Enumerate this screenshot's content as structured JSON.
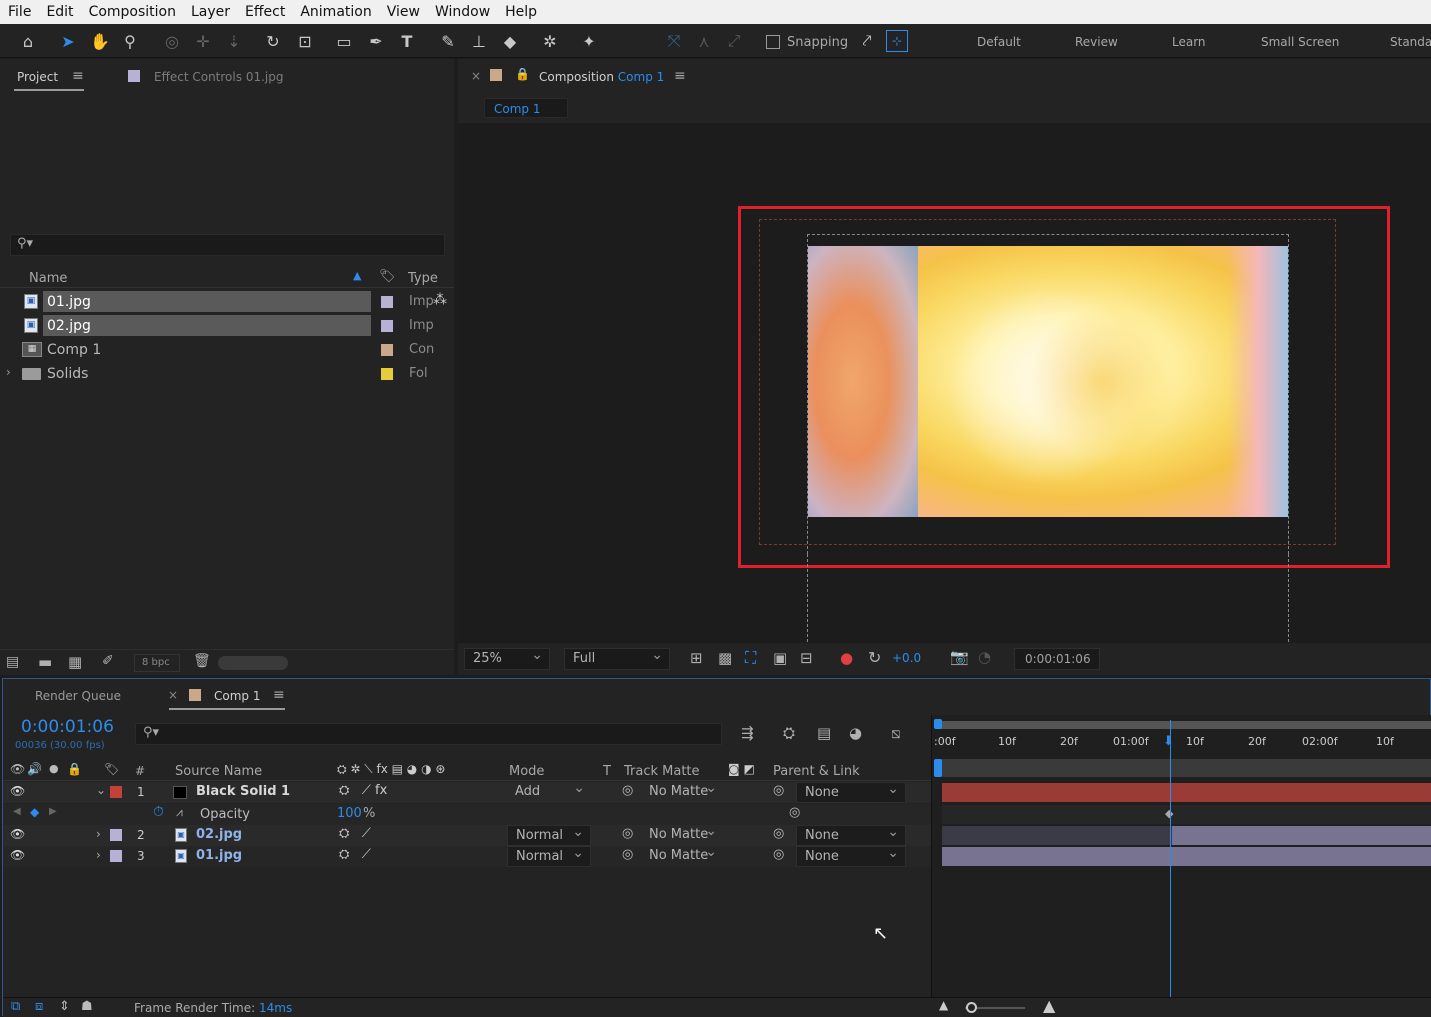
{
  "menu": [
    "File",
    "Edit",
    "Composition",
    "Layer",
    "Effect",
    "Animation",
    "View",
    "Window",
    "Help"
  ],
  "toolbar": {
    "snapping_label": "Snapping"
  },
  "workspaces": [
    "Default",
    "Review",
    "Learn",
    "Small Screen",
    "Standa"
  ],
  "project_panel": {
    "tab_project": "Project",
    "tab_effect_controls": "Effect Controls",
    "effect_controls_target": "01.jpg",
    "search_placeholder": "",
    "col_name": "Name",
    "col_type": "Type",
    "items": [
      {
        "name": "01.jpg",
        "type": "Imp",
        "color": "#b7b1d6",
        "selected": true
      },
      {
        "name": "02.jpg",
        "type": "Imp",
        "color": "#b7b1d6",
        "selected": true
      },
      {
        "name": "Comp 1",
        "type": "Con",
        "color": "#c9a98a",
        "selected": false
      },
      {
        "name": "Solids",
        "type": "Fol",
        "color": "#e6cc3a",
        "selected": false
      }
    ],
    "bpc_label": "8 bpc"
  },
  "comp_panel": {
    "tab_prefix": "Composition",
    "tab_name": "Comp 1",
    "breadcrumb": "Comp 1",
    "zoom": "25%",
    "resolution": "Full",
    "exposure": "+0.0",
    "timecode": "0:00:01:06"
  },
  "timeline": {
    "tab_render_queue": "Render Queue",
    "tab_comp": "Comp 1",
    "timecode": "0:00:01:06",
    "frame_info": "00036 (30.00 fps)",
    "headers": {
      "hash": "#",
      "source": "Source Name",
      "mode": "Mode",
      "t": "T",
      "track_matte": "Track Matte",
      "parent": "Parent & Link"
    },
    "ruler": [
      ":00f",
      "10f",
      "20f",
      "01:00f",
      "10f",
      "20f",
      "02:00f",
      "10f"
    ],
    "layers": [
      {
        "num": "1",
        "name": "Black Solid 1",
        "mode": "Add",
        "matte": "No Matte",
        "parent": "None",
        "label": "#c0423a"
      },
      {
        "num": "2",
        "name": "02.jpg",
        "mode": "Normal",
        "matte": "No Matte",
        "parent": "None",
        "label": "#b7b1d6"
      },
      {
        "num": "3",
        "name": "01.jpg",
        "mode": "Normal",
        "matte": "No Matte",
        "parent": "None",
        "label": "#b7b1d6"
      }
    ],
    "opacity": {
      "label": "Opacity",
      "value": "100",
      "unit": "%"
    },
    "frame_render_label": "Frame Render Time:",
    "frame_render_value": "14ms"
  }
}
